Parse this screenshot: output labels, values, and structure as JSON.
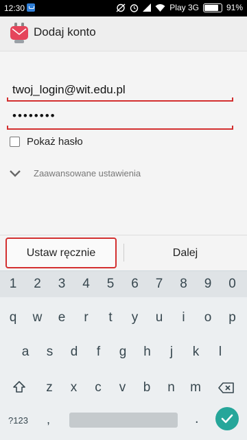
{
  "status_bar": {
    "time": "12:30",
    "carrier": "Play 3G",
    "battery": "91%",
    "battery_level": 0.91
  },
  "app_bar": {
    "title": "Dodaj konto"
  },
  "form": {
    "login_value": "twoj_login@wit.edu.pl",
    "password_value": "••••••••",
    "show_password_label": "Pokaż hasło",
    "advanced_label": "Zaawansowane ustawienia"
  },
  "buttons": {
    "manual_label": "Ustaw ręcznie",
    "next_label": "Dalej"
  },
  "keyboard": {
    "numbers": [
      "1",
      "2",
      "3",
      "4",
      "5",
      "6",
      "7",
      "8",
      "9",
      "0"
    ],
    "row1": [
      "q",
      "w",
      "e",
      "r",
      "t",
      "y",
      "u",
      "i",
      "o",
      "p"
    ],
    "row2": [
      "a",
      "s",
      "d",
      "f",
      "g",
      "h",
      "j",
      "k",
      "l"
    ],
    "row3": [
      "z",
      "x",
      "c",
      "v",
      "b",
      "n",
      "m"
    ],
    "sym_label": "?123",
    "comma": ",",
    "period": "."
  },
  "colors": {
    "accent": "#d32f2f",
    "enter": "#26a69a"
  }
}
